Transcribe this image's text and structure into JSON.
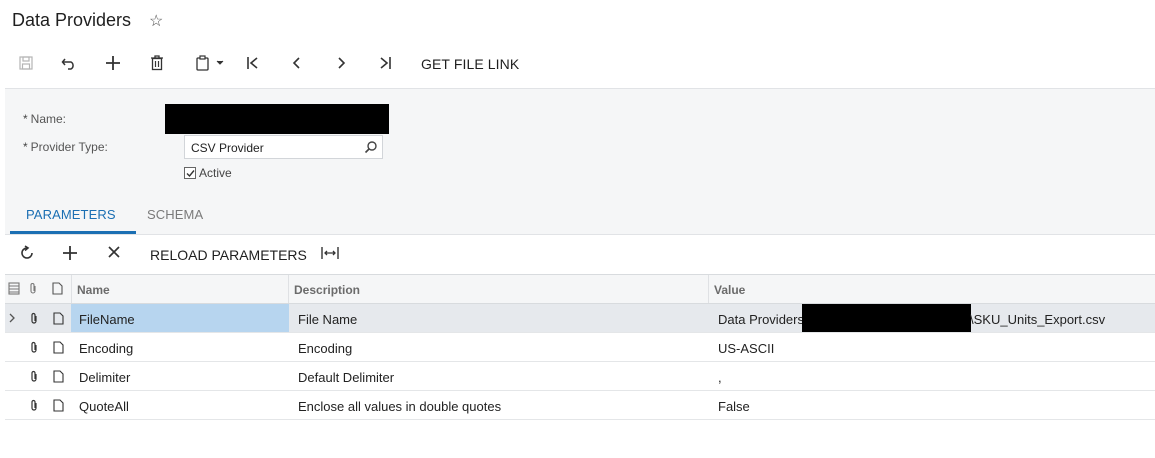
{
  "page": {
    "title": "Data Providers"
  },
  "toolbar": {
    "get_file_link": "GET FILE LINK"
  },
  "form": {
    "name_label": "Name:",
    "provider_type_label": "Provider Type:",
    "provider_type_value": "CSV Provider",
    "active_label": "Active",
    "required_mark": "*"
  },
  "tabs": [
    {
      "label": "PARAMETERS",
      "active": true
    },
    {
      "label": "SCHEMA",
      "active": false
    }
  ],
  "grid_toolbar": {
    "reload_parameters": "RELOAD PARAMETERS"
  },
  "grid": {
    "columns": {
      "name": "Name",
      "description": "Description",
      "value": "Value"
    },
    "rows": [
      {
        "name": "FileName",
        "description": "File Name",
        "value_prefix": "Data Providers",
        "value_suffix": "\\SKU_Units_Export.csv",
        "selected": true
      },
      {
        "name": "Encoding",
        "description": "Encoding",
        "value": "US-ASCII"
      },
      {
        "name": "Delimiter",
        "description": "Default Delimiter",
        "value": ","
      },
      {
        "name": "QuoteAll",
        "description": "Enclose all values in double quotes",
        "value": "False"
      }
    ]
  },
  "colors": {
    "accent": "#1b6fb3",
    "selected_cell": "#b7d5ef",
    "selected_row": "#e6e9ed"
  }
}
